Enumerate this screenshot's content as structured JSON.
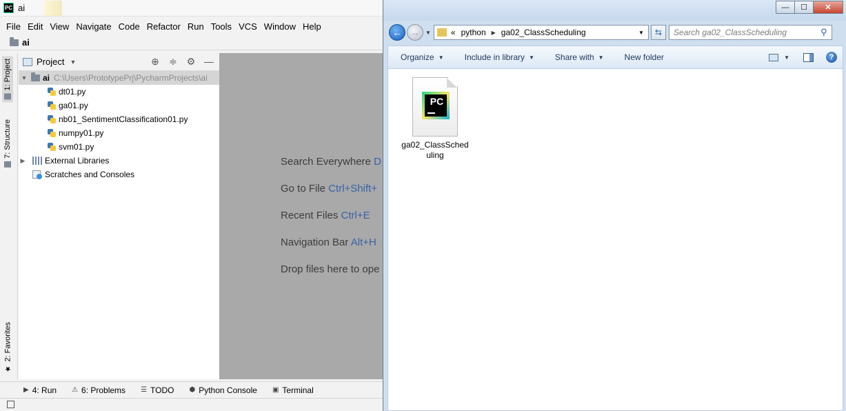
{
  "ide": {
    "window_title": "ai",
    "logo_text": "PC",
    "menu": [
      "File",
      "Edit",
      "View",
      "Navigate",
      "Code",
      "Refactor",
      "Run",
      "Tools",
      "VCS",
      "Window",
      "Help"
    ],
    "breadcrumb": "ai",
    "side_tabs": {
      "project": "1: Project",
      "structure": "7: Structure",
      "favorites": "2: Favorites"
    },
    "project_panel": {
      "title": "Project",
      "root": {
        "name": "ai",
        "path": "C:\\Users\\PrototypePrj\\PycharmProjects\\ai"
      },
      "files": [
        "dt01.py",
        "ga01.py",
        "nb01_SentimentClassification01.py",
        "numpy01.py",
        "svm01.py"
      ],
      "external_libraries": "External Libraries",
      "scratches": "Scratches and Consoles"
    },
    "editor_hints": [
      {
        "label": "Search Everywhere",
        "key": "D"
      },
      {
        "label": "Go to File",
        "key": "Ctrl+Shift+"
      },
      {
        "label": "Recent Files",
        "key": "Ctrl+E"
      },
      {
        "label": "Navigation Bar",
        "key": "Alt+H"
      },
      {
        "label": "Drop files here to ope",
        "key": ""
      }
    ],
    "tool_windows": [
      "4: Run",
      "6: Problems",
      "TODO",
      "Python Console",
      "Terminal"
    ]
  },
  "explorer": {
    "address": {
      "overflow": "«",
      "segments": [
        "python",
        "ga02_ClassScheduling"
      ]
    },
    "search_placeholder": "Search ga02_ClassScheduling",
    "commands": [
      "Organize",
      "Include in library",
      "Share with",
      "New folder"
    ],
    "files": [
      {
        "name": "ga02_ClassScheduling",
        "icon_text": "PC"
      }
    ],
    "window_buttons": {
      "minimize": "—",
      "maximize": "☐",
      "close": "✕"
    }
  },
  "colors": {
    "editor_bg": "#a9a9a9",
    "explorer_chrome": "#cfdff0",
    "hint_key": "#3862a8"
  }
}
